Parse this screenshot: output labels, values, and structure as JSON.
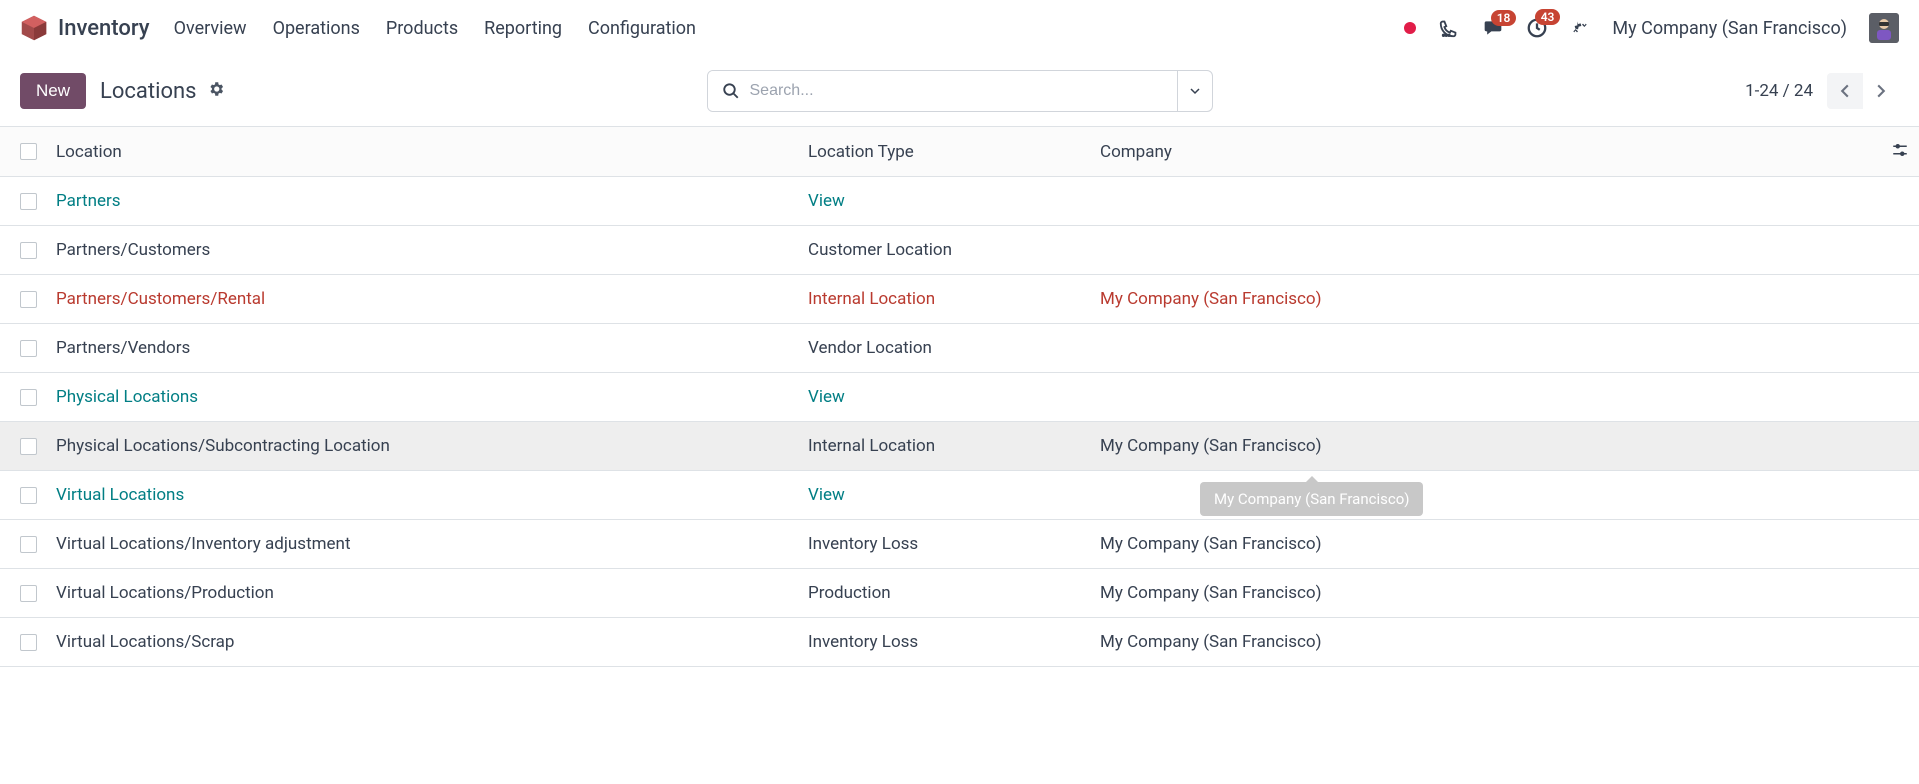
{
  "header": {
    "app_title": "Inventory",
    "nav": [
      "Overview",
      "Operations",
      "Products",
      "Reporting",
      "Configuration"
    ],
    "badge_messages": "18",
    "badge_activities": "43",
    "company": "My Company (San Francisco)"
  },
  "controlbar": {
    "new_label": "New",
    "page_title": "Locations",
    "search_placeholder": "Search...",
    "pager": "1-24 / 24"
  },
  "table": {
    "headers": {
      "location": "Location",
      "type": "Location Type",
      "company": "Company"
    },
    "rows": [
      {
        "location": "Partners",
        "type": "View",
        "company": "",
        "style": "teal"
      },
      {
        "location": "Partners/Customers",
        "type": "Customer Location",
        "company": "",
        "style": ""
      },
      {
        "location": "Partners/Customers/Rental",
        "type": "Internal Location",
        "company": "My Company (San Francisco)",
        "style": "red"
      },
      {
        "location": "Partners/Vendors",
        "type": "Vendor Location",
        "company": "",
        "style": ""
      },
      {
        "location": "Physical Locations",
        "type": "View",
        "company": "",
        "style": "teal"
      },
      {
        "location": "Physical Locations/Subcontracting Location",
        "type": "Internal Location",
        "company": "My Company (San Francisco)",
        "style": "",
        "hovered": true,
        "tooltip": "My Company (San Francisco)"
      },
      {
        "location": "Virtual Locations",
        "type": "View",
        "company": "",
        "style": "teal"
      },
      {
        "location": "Virtual Locations/Inventory adjustment",
        "type": "Inventory Loss",
        "company": "My Company (San Francisco)",
        "style": ""
      },
      {
        "location": "Virtual Locations/Production",
        "type": "Production",
        "company": "My Company (San Francisco)",
        "style": ""
      },
      {
        "location": "Virtual Locations/Scrap",
        "type": "Inventory Loss",
        "company": "My Company (San Francisco)",
        "style": ""
      }
    ]
  }
}
